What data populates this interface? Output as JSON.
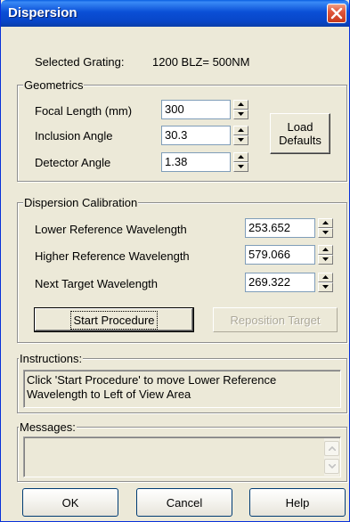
{
  "window": {
    "title": "Dispersion"
  },
  "selected_grating": {
    "label": "Selected Grating:",
    "value": "1200 BLZ= 500NM"
  },
  "geometrics": {
    "legend": "Geometrics",
    "focal_length": {
      "label": "Focal Length (mm)",
      "value": "300"
    },
    "inclusion_angle": {
      "label": "Inclusion Angle",
      "value": "30.3"
    },
    "detector_angle": {
      "label": "Detector Angle",
      "value": "1.38"
    },
    "load_defaults_line1": "Load",
    "load_defaults_line2": "Defaults"
  },
  "calibration": {
    "legend": "Dispersion Calibration",
    "lower_ref": {
      "label": "Lower Reference Wavelength",
      "value": "253.652"
    },
    "higher_ref": {
      "label": "Higher Reference Wavelength",
      "value": "579.066"
    },
    "next_target": {
      "label": "Next Target Wavelength",
      "value": "269.322"
    },
    "start_label": "Start Procedure",
    "reposition_label": "Reposition Target"
  },
  "instructions": {
    "legend": "Instructions:",
    "line1": "Click 'Start Procedure' to move Lower Reference",
    "line2": "Wavelength to Left of View Area"
  },
  "messages": {
    "legend": "Messages:",
    "text": ""
  },
  "buttons": {
    "ok": "OK",
    "cancel": "Cancel",
    "help": "Help"
  },
  "colors": {
    "titlebar": "#0a4fd6",
    "dialog_bg": "#ece9d8",
    "close_button": "#e0563b"
  }
}
